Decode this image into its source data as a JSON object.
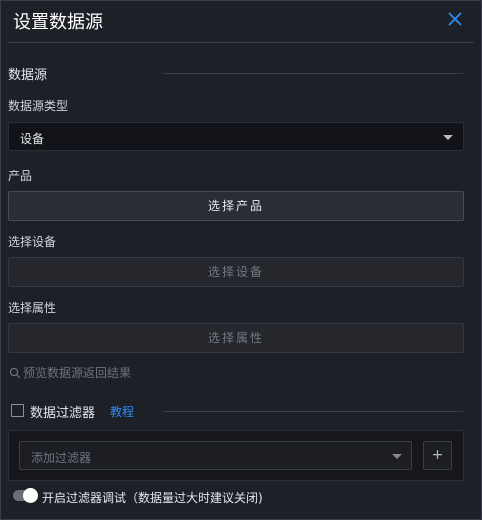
{
  "dialog": {
    "title": "设置数据源"
  },
  "datasource": {
    "section_title": "数据源",
    "type_label": "数据源类型",
    "type_value": "设备",
    "product_label": "产品",
    "product_button": "选择产品",
    "device_label": "选择设备",
    "device_button": "选择设备",
    "property_label": "选择属性",
    "property_button": "选择属性",
    "preview_link": "预览数据源返回结果"
  },
  "filter": {
    "section_title": "数据过滤器",
    "tutorial_link": "教程",
    "placeholder": "添加过滤器",
    "add_symbol": "+",
    "debug_label": "开启过滤器调试（数据量过大时建议关闭)"
  },
  "icons": {
    "close": "close-icon",
    "search": "search-icon",
    "dropdown": "chevron-down-icon"
  },
  "colors": {
    "accent": "#2f8bf0",
    "background": "#1e2027"
  }
}
